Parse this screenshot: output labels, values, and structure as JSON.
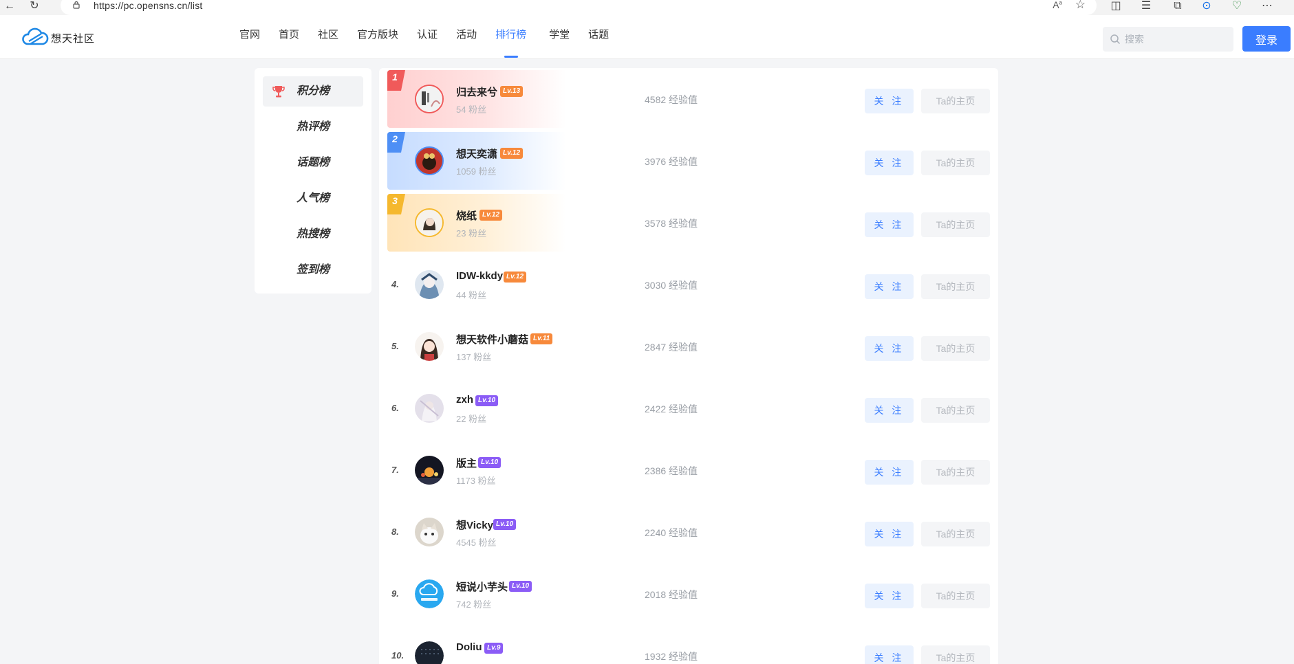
{
  "browser": {
    "url": "https://pc.opensns.cn/list"
  },
  "header": {
    "logo_text": "想天社区",
    "nav": [
      {
        "label": "官网",
        "active": false
      },
      {
        "label": "首页",
        "active": false
      },
      {
        "label": "社区",
        "active": false
      },
      {
        "label": "官方版块",
        "active": false
      },
      {
        "label": "认证",
        "active": false
      },
      {
        "label": "活动",
        "active": false
      },
      {
        "label": "排行榜",
        "active": true
      },
      {
        "label": "学堂",
        "active": false
      },
      {
        "label": "话题",
        "active": false
      }
    ],
    "search_placeholder": "搜索",
    "login_label": "登录"
  },
  "sidebar": {
    "items": [
      {
        "label": "积分榜",
        "active": true
      },
      {
        "label": "热评榜",
        "active": false
      },
      {
        "label": "话题榜",
        "active": false
      },
      {
        "label": "人气榜",
        "active": false
      },
      {
        "label": "热搜榜",
        "active": false
      },
      {
        "label": "签到榜",
        "active": false
      }
    ]
  },
  "ranking": {
    "follow_label": "关 注",
    "home_label": "Ta的主页",
    "rows": [
      {
        "rank": "1",
        "name": "归去来兮",
        "level": "Lv.13",
        "fans": "54 粉丝",
        "exp": "4582 经验值"
      },
      {
        "rank": "2",
        "name": "想天奕潇",
        "level": "Lv.12",
        "fans": "1059 粉丝",
        "exp": "3976 经验值"
      },
      {
        "rank": "3",
        "name": "烧纸",
        "level": "Lv.12",
        "fans": "23 粉丝",
        "exp": "3578 经验值"
      },
      {
        "rank": "4.",
        "name": "IDW-kkdy",
        "level": "Lv.12",
        "fans": "44 粉丝",
        "exp": "3030 经验值"
      },
      {
        "rank": "5.",
        "name": "想天软件小蘑菇",
        "level": "Lv.11",
        "fans": "137 粉丝",
        "exp": "2847 经验值"
      },
      {
        "rank": "6.",
        "name": "zxh",
        "level": "Lv.10",
        "fans": "22 粉丝",
        "exp": "2422 经验值"
      },
      {
        "rank": "7.",
        "name": "版主",
        "level": "Lv.10",
        "fans": "1173 粉丝",
        "exp": "2386 经验值"
      },
      {
        "rank": "8.",
        "name": "想Vicky",
        "level": "Lv.10",
        "fans": "4545 粉丝",
        "exp": "2240 经验值"
      },
      {
        "rank": "9.",
        "name": "短说小芋头",
        "level": "Lv.10",
        "fans": "742 粉丝",
        "exp": "2018 经验值"
      },
      {
        "rank": "10.",
        "name": "Doliu",
        "level": "Lv.9",
        "fans": "",
        "exp": "1932 经验值"
      }
    ]
  },
  "colors": {
    "accent": "#3a7dff",
    "rank1": "#f05a5a",
    "rank2": "#4e8ff5",
    "rank3": "#f5b82e",
    "level_orange": "#f7893b",
    "level_purple": "#8b5cf6"
  }
}
